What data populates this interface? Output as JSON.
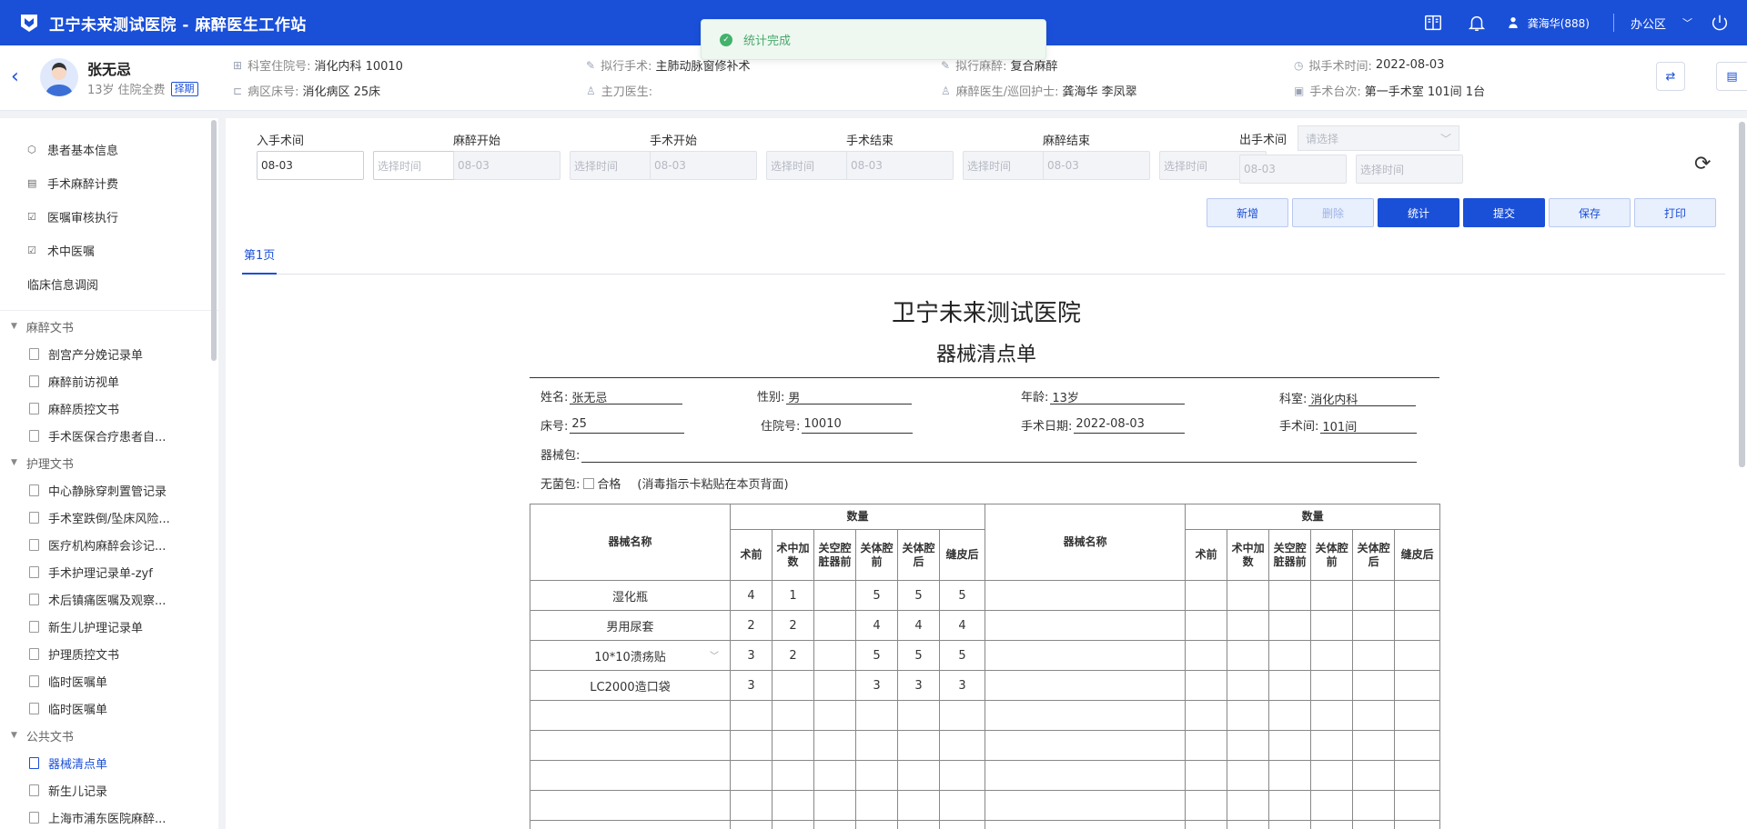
{
  "app": {
    "title": "卫宁未来测试医院 - 麻醉医生工作站"
  },
  "toast": {
    "message": "统计完成"
  },
  "topbar": {
    "user": "龚海华(888)",
    "area": "办公区"
  },
  "patient": {
    "name": "张无忌",
    "age": "13岁",
    "fee_type": "住院全费",
    "tag": "择期",
    "dept_label": "科室住院号:",
    "dept_value": "消化内科 10010",
    "ward_label": "病区床号:",
    "ward_value": "消化病区 25床",
    "op_label": "拟行手术:",
    "op_value": "主肺动脉窗修补术",
    "surgeon_label": "主刀医生:",
    "surgeon_value": "",
    "anes_label": "拟行麻醉:",
    "anes_value": "复合麻醉",
    "staff_label": "麻醉医生/巡回护士:",
    "staff_value": "龚海华 李凤翠",
    "time_label": "拟手术时间:",
    "time_value": "2022-08-03",
    "room_label": "手术台次:",
    "room_value": "第一手术室 101间 1台"
  },
  "sidebar": {
    "top_items": [
      {
        "label": "患者基本信息",
        "icon": "cube-icon"
      },
      {
        "label": "手术麻醉计费",
        "icon": "bill-icon"
      },
      {
        "label": "医嘱审核执行",
        "icon": "check-doc-icon"
      },
      {
        "label": "术中医嘱",
        "icon": "check-doc-icon"
      },
      {
        "label": "临床信息调阅"
      }
    ],
    "groups": [
      {
        "label": "麻醉文书",
        "items": [
          "剖宫产分娩记录单",
          "麻醉前访视单",
          "麻醉质控文书",
          "手术医保合疗患者自..."
        ]
      },
      {
        "label": "护理文书",
        "items": [
          "中心静脉穿刺置管记录",
          "手术室跌倒/坠床风险...",
          "医疗机构麻醉会诊记...",
          "手术护理记录单-zyf",
          "术后镇痛医嘱及观察...",
          "新生儿护理记录单",
          "护理质控文书",
          "临时医嘱单",
          "临时医嘱单"
        ]
      },
      {
        "label": "公共文书",
        "items": [
          "器械清点单",
          "新生儿记录",
          "上海市浦东医院麻醉..."
        ]
      }
    ],
    "active_item": "器械清点单"
  },
  "times": [
    {
      "label": "入手术间",
      "date": "08-03",
      "time_placeholder": "选择时间"
    },
    {
      "label": "麻醉开始",
      "date": "08-03",
      "time_placeholder": "选择时间"
    },
    {
      "label": "手术开始",
      "date": "08-03",
      "time_placeholder": "选择时间"
    },
    {
      "label": "手术结束",
      "date": "08-03",
      "time_placeholder": "选择时间"
    },
    {
      "label": "麻醉结束",
      "date": "08-03",
      "time_placeholder": "选择时间"
    },
    {
      "label": "出手术间",
      "select_placeholder": "请选择",
      "date": "08-03",
      "time_placeholder": "选择时间"
    }
  ],
  "actions": {
    "add": "新增",
    "delete": "删除",
    "stats": "统计",
    "submit": "提交",
    "save": "保存",
    "print": "打印"
  },
  "tabs": [
    "第1页"
  ],
  "form": {
    "hospital": "卫宁未来测试医院",
    "title": "器械清点单",
    "name_label": "姓名:",
    "name": "张无忌",
    "sex_label": "性别:",
    "sex": "男",
    "age_label": "年龄:",
    "age": "13岁",
    "dept_label": "科室:",
    "dept": "消化内科",
    "bed_label": "床号:",
    "bed": "25",
    "inpatient_label": "住院号:",
    "inpatient": "10010",
    "opdate_label": "手术日期:",
    "opdate": "2022-08-03",
    "room_label": "手术间:",
    "room": "101间",
    "package_label": "器械包:",
    "sterile_label": "无菌包:",
    "qualified": "合格",
    "sterile_note": "(消毒指示卡粘贴在本页背面)"
  },
  "table": {
    "name_header": "器械名称",
    "qty_header": "数量",
    "sub_headers": [
      "术前",
      "术中加数",
      "关空腔脏器前",
      "关体腔前",
      "关体腔后",
      "缝皮后"
    ],
    "rows": [
      {
        "name": "湿化瓶",
        "values": [
          "4",
          "1",
          "",
          "5",
          "5",
          "5"
        ]
      },
      {
        "name": "男用尿套",
        "values": [
          "2",
          "2",
          "",
          "4",
          "4",
          "4"
        ]
      },
      {
        "name": "10*10溃疡贴",
        "values": [
          "3",
          "2",
          "",
          "5",
          "5",
          "5"
        ]
      },
      {
        "name": "LC2000造口袋",
        "values": [
          "3",
          "",
          "",
          "3",
          "3",
          "3"
        ]
      },
      {
        "name": "",
        "values": [
          "",
          "",
          "",
          "",
          "",
          ""
        ]
      },
      {
        "name": "",
        "values": [
          "",
          "",
          "",
          "",
          "",
          ""
        ]
      },
      {
        "name": "",
        "values": [
          "",
          "",
          "",
          "",
          "",
          ""
        ]
      },
      {
        "name": "",
        "values": [
          "",
          "",
          "",
          "",
          "",
          ""
        ]
      },
      {
        "name": "",
        "values": [
          "",
          "",
          "",
          "",
          "",
          ""
        ]
      }
    ]
  }
}
